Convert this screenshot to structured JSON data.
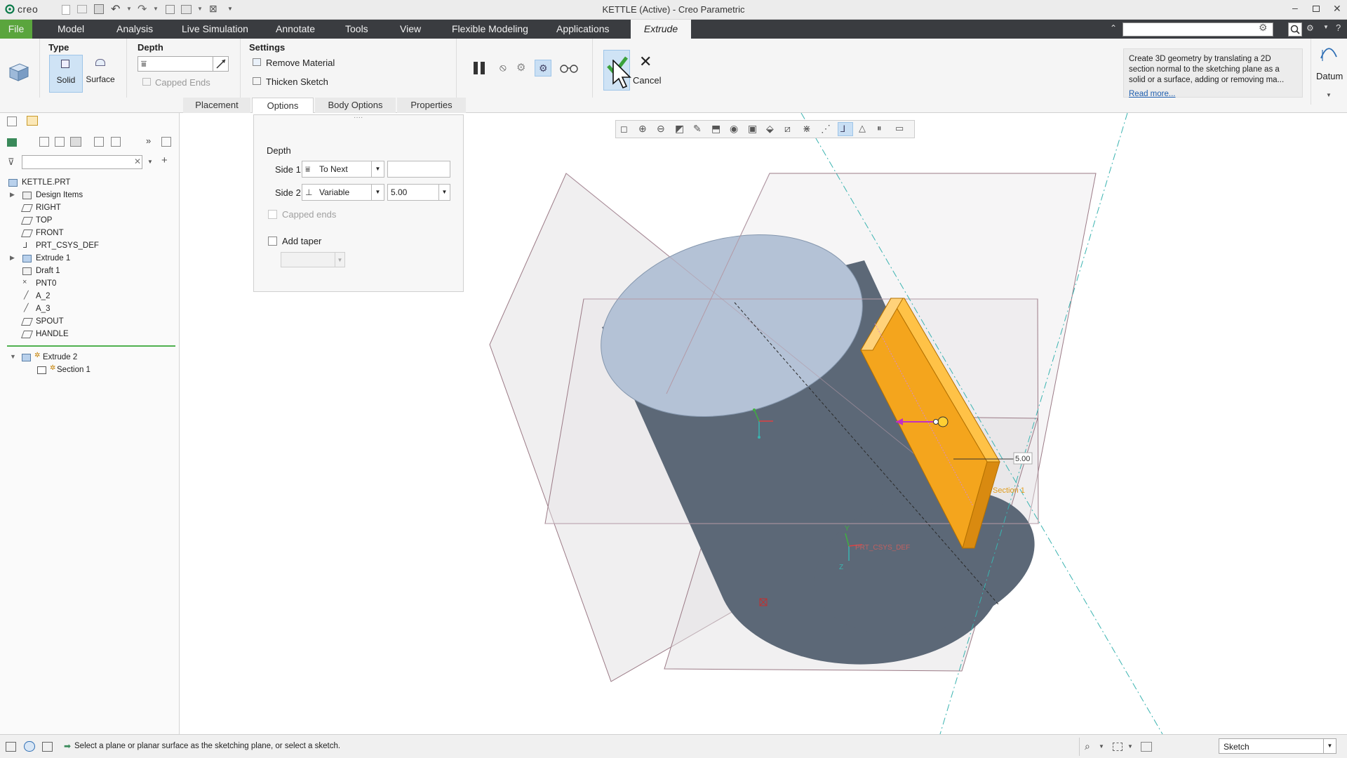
{
  "app": {
    "logo": "creo",
    "window_title": "KETTLE (Active) - Creo Parametric"
  },
  "menu": {
    "items": [
      "File",
      "Model",
      "Analysis",
      "Live Simulation",
      "Annotate",
      "Tools",
      "View",
      "Flexible Modeling",
      "Applications"
    ],
    "active_tab": "Extrude"
  },
  "ribbon": {
    "type_label": "Type",
    "solid_label": "Solid",
    "surface_label": "Surface",
    "depth_label": "Depth",
    "depth_value": "",
    "capped_ends_label": "Capped Ends",
    "settings_label": "Settings",
    "remove_material_label": "Remove Material",
    "thicken_sketch_label": "Thicken Sketch",
    "cancel_label": "Cancel",
    "tooltip_text": "Create 3D geometry by translating a 2D section normal to the sketching plane as a solid or a surface, adding or removing ma...",
    "read_more": "Read more...",
    "datum_label": "Datum",
    "search_placeholder": ""
  },
  "subtabs": [
    "Placement",
    "Options",
    "Body Options",
    "Properties"
  ],
  "options_panel": {
    "depth_label": "Depth",
    "side1_label": "Side 1",
    "side1_value": "To Next",
    "side1_depth": "",
    "side2_label": "Side 2",
    "side2_value": "Variable",
    "side2_depth": "5.00",
    "capped_ends_label": "Capped ends",
    "add_taper_label": "Add taper",
    "taper_value": ""
  },
  "model_tree": {
    "root": "KETTLE.PRT",
    "items": [
      "Design Items",
      "RIGHT",
      "TOP",
      "FRONT",
      "PRT_CSYS_DEF",
      "Extrude 1",
      "Draft 1",
      "PNT0",
      "A_2",
      "A_3",
      "SPOUT",
      "HANDLE"
    ],
    "insert_items": [
      "Extrude 2",
      "Section 1"
    ],
    "search_value": ""
  },
  "viewport": {
    "dimension_value": "5.00",
    "section_label": "Section 1",
    "csys_label": "PRT_CSYS_DEF"
  },
  "status": {
    "message": "Select a plane or planar surface as the sketching plane, or select a sketch.",
    "filter_value": "Sketch"
  },
  "colors": {
    "menubar": "#3a3c40",
    "file_tab": "#5aa53d",
    "confirm_green": "#3aa13a",
    "feature_orange": "#f4a51d",
    "body_dark": "#5c6877",
    "body_top": "#b4c2d6",
    "accent_blue": "#1f5fb0"
  }
}
